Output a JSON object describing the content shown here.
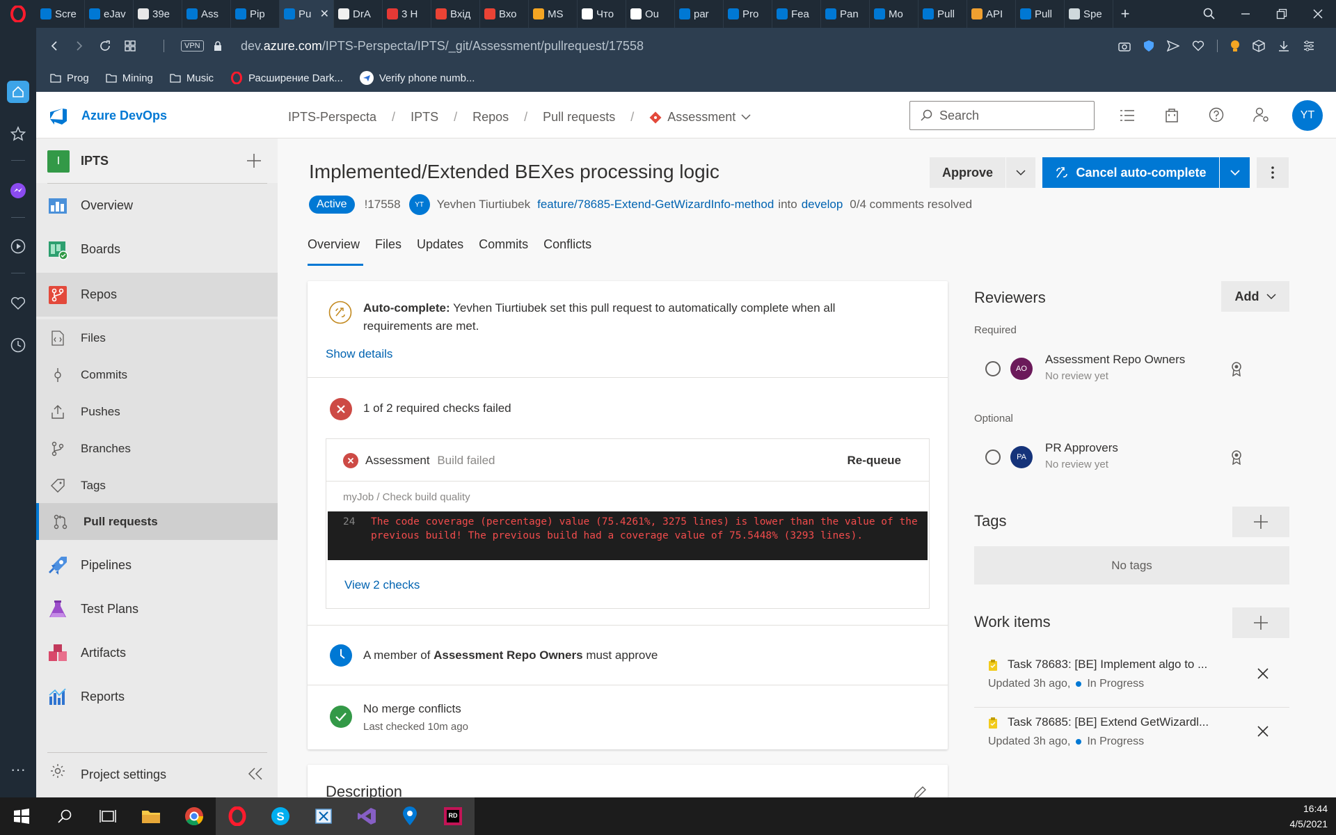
{
  "browser": {
    "tabs": [
      {
        "label": "Scre",
        "color": "#0078d4"
      },
      {
        "label": "eJav",
        "color": "#0078d4"
      },
      {
        "label": "39e",
        "color": "#e8e8e8"
      },
      {
        "label": "Ass",
        "color": "#0078d4"
      },
      {
        "label": "Pip",
        "color": "#0078d4"
      },
      {
        "label": "Pu",
        "color": "#0078d4"
      },
      {
        "label": "DrA",
        "color": "#f0f0f0"
      },
      {
        "label": "3 H",
        "color": "#e53935"
      },
      {
        "label": "Вхід",
        "color": "#ea4335"
      },
      {
        "label": "Вхо",
        "color": "#ea4335"
      },
      {
        "label": "MS",
        "color": "#f5a623"
      },
      {
        "label": "Что",
        "color": "#ffffff"
      },
      {
        "label": "Ou",
        "color": "#ffffff"
      },
      {
        "label": "par",
        "color": "#0078d4"
      },
      {
        "label": "Pro",
        "color": "#0078d4"
      },
      {
        "label": "Fea",
        "color": "#0078d4"
      },
      {
        "label": "Pan",
        "color": "#0078d4"
      },
      {
        "label": "Mo",
        "color": "#0078d4"
      },
      {
        "label": "Pull",
        "color": "#0078d4"
      },
      {
        "label": "API",
        "color": "#f0a030"
      },
      {
        "label": "Pull",
        "color": "#0078d4"
      },
      {
        "label": "Spe",
        "color": "#cfd8dc"
      }
    ],
    "vpn_label": "VPN",
    "url_prefix": "dev.",
    "url_domain": "azure.com",
    "url_path": "/IPTS-Perspecta/IPTS/_git/Assessment/pullrequest/17558",
    "bookmarks": [
      {
        "label": "Prog",
        "icon": "folder-icon"
      },
      {
        "label": "Mining",
        "icon": "folder-icon"
      },
      {
        "label": "Music",
        "icon": "folder-icon"
      },
      {
        "label": "Расширение Dark...",
        "icon": "opera-icon"
      },
      {
        "label": "Verify phone numb...",
        "icon": "send-icon"
      }
    ]
  },
  "header": {
    "logo_text": "Azure DevOps",
    "breadcrumb": [
      "IPTS-Perspecta",
      "IPTS",
      "Repos",
      "Pull requests",
      "Assessment"
    ],
    "search_placeholder": "Search",
    "avatar_initials": "YT"
  },
  "sidebar": {
    "project_initial": "I",
    "project_name": "IPTS",
    "items": [
      {
        "label": "Overview"
      },
      {
        "label": "Boards"
      },
      {
        "label": "Repos"
      },
      {
        "label": "Files"
      },
      {
        "label": "Commits"
      },
      {
        "label": "Pushes"
      },
      {
        "label": "Branches"
      },
      {
        "label": "Tags"
      },
      {
        "label": "Pull requests"
      },
      {
        "label": "Pipelines"
      },
      {
        "label": "Test Plans"
      },
      {
        "label": "Artifacts"
      },
      {
        "label": "Reports"
      }
    ],
    "settings_label": "Project settings"
  },
  "pr": {
    "title": "Implemented/Extended BEXes processing logic",
    "status": "Active",
    "id": "!17558",
    "author_initials": "YT",
    "author": "Yevhen Tiurtiubek",
    "source_branch": "feature/78685-Extend-GetWizardInfo-method",
    "into": "into",
    "target_branch": "develop",
    "comments": "0/4 comments resolved",
    "approve_label": "Approve",
    "cancel_label": "Cancel auto-complete",
    "tabs": [
      "Overview",
      "Files",
      "Updates",
      "Commits",
      "Conflicts"
    ]
  },
  "status_card": {
    "autocomplete_bold": "Auto-complete:",
    "autocomplete_text": "Yevhen Tiurtiubek set this pull request to automatically complete when all requirements are met.",
    "show_details": "Show details",
    "checks_summary": "1 of 2 required checks failed",
    "check_name": "Assessment",
    "check_status": "Build failed",
    "requeue": "Re-queue",
    "job_path": "myJob / Check build quality",
    "log_line": "24",
    "log_text": "The code coverage (percentage) value (75.4261%, 3275 lines) is lower than the value of the previous build! The previous build had a coverage value of 75.5448% (3293 lines).",
    "view_checks": "View 2 checks",
    "approval_prefix": "A member of",
    "approval_group": "Assessment Repo Owners",
    "approval_suffix": "must approve",
    "merge_title": "No merge conflicts",
    "merge_sub": "Last checked 10m ago",
    "description_title": "Description"
  },
  "reviewers": {
    "title": "Reviewers",
    "add_label": "Add",
    "required_label": "Required",
    "optional_label": "Optional",
    "required": [
      {
        "initials": "AO",
        "name": "Assessment Repo Owners",
        "status": "No review yet",
        "color": "#6b1a5a"
      }
    ],
    "optional": [
      {
        "initials": "PA",
        "name": "PR Approvers",
        "status": "No review yet",
        "color": "#15337a"
      }
    ]
  },
  "tags": {
    "title": "Tags",
    "empty": "No tags"
  },
  "work_items": {
    "title": "Work items",
    "items": [
      {
        "title": "Task 78683: [BE] Implement algo to ...",
        "updated": "Updated 3h ago,",
        "state": "In Progress"
      },
      {
        "title": "Task 78685: [BE] Extend GetWizardl...",
        "updated": "Updated 3h ago,",
        "state": "In Progress"
      }
    ]
  },
  "taskbar": {
    "time": "16:44",
    "date": "4/5/2021"
  }
}
